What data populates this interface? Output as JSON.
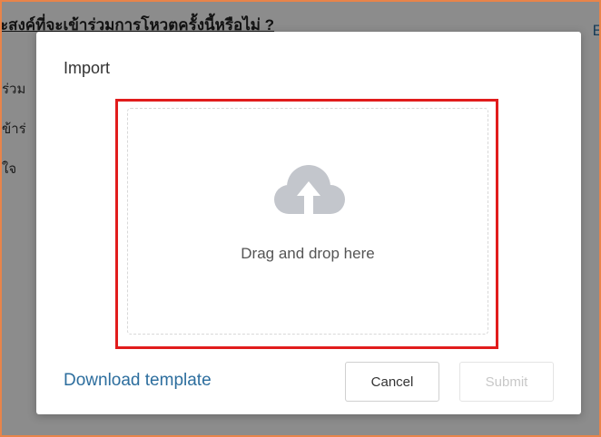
{
  "background": {
    "question": "ะสงค์ที่จะเข้าร่วมการโหวตครั้งนี้หรือไม่ ?",
    "options": [
      "ร่วม",
      "ข้าร่",
      "ใจ"
    ],
    "edit_label": "E"
  },
  "modal": {
    "title": "Import",
    "dropzone": {
      "icon": "cloud-upload-icon",
      "text": "Drag and drop here"
    },
    "download_template_label": "Download template",
    "cancel_label": "Cancel",
    "submit_label": "Submit"
  },
  "colors": {
    "highlight_border": "#e11c1c",
    "link": "#2d6e9e",
    "icon": "#c3c6cc",
    "frame_border": "#e8844a"
  }
}
